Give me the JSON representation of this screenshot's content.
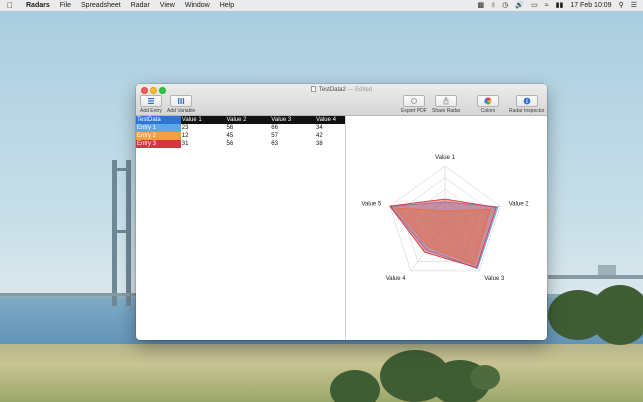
{
  "menubar": {
    "app": "Radars",
    "items": [
      "File",
      "Spreadsheet",
      "Radar",
      "View",
      "Window",
      "Help"
    ],
    "clock": "17 Feb 10:09"
  },
  "window": {
    "title": "TestData2",
    "edited": "— Edited"
  },
  "toolbar": {
    "add_entry": "Add Entry",
    "add_variable": "Add Variable",
    "export_pdf": "Export PDF",
    "share_radar": "Share Radar",
    "colors": "Colors",
    "radar_inspector": "Radar Inspector"
  },
  "sheet": {
    "corner": "TestData",
    "headers": [
      "Value 1",
      "Value 2",
      "Value 3",
      "Value 4"
    ],
    "rows": [
      {
        "label": "Entry 1",
        "values": [
          "23",
          "56",
          "66",
          "34"
        ]
      },
      {
        "label": "Entry 2",
        "values": [
          "12",
          "45",
          "57",
          "42"
        ]
      },
      {
        "label": "Entry 3",
        "values": [
          "31",
          "56",
          "63",
          "38"
        ]
      }
    ]
  },
  "radar": {
    "axes": [
      "Value 1",
      "Value 2",
      "Value 3",
      "Value 4",
      "Value 5"
    ],
    "max": 100,
    "series": [
      {
        "values": [
          38,
          96,
          95,
          55,
          98
        ],
        "color": "#5fa7e6"
      },
      {
        "values": [
          22,
          82,
          86,
          48,
          90
        ],
        "color": "#f0a043"
      },
      {
        "values": [
          43,
          93,
          93,
          60,
          100
        ],
        "color": "#d93540"
      }
    ]
  },
  "colors": {
    "entry1": "#5fa7e6",
    "entry2": "#f0a043",
    "entry3": "#d93540",
    "accent": "#2f73d4"
  }
}
